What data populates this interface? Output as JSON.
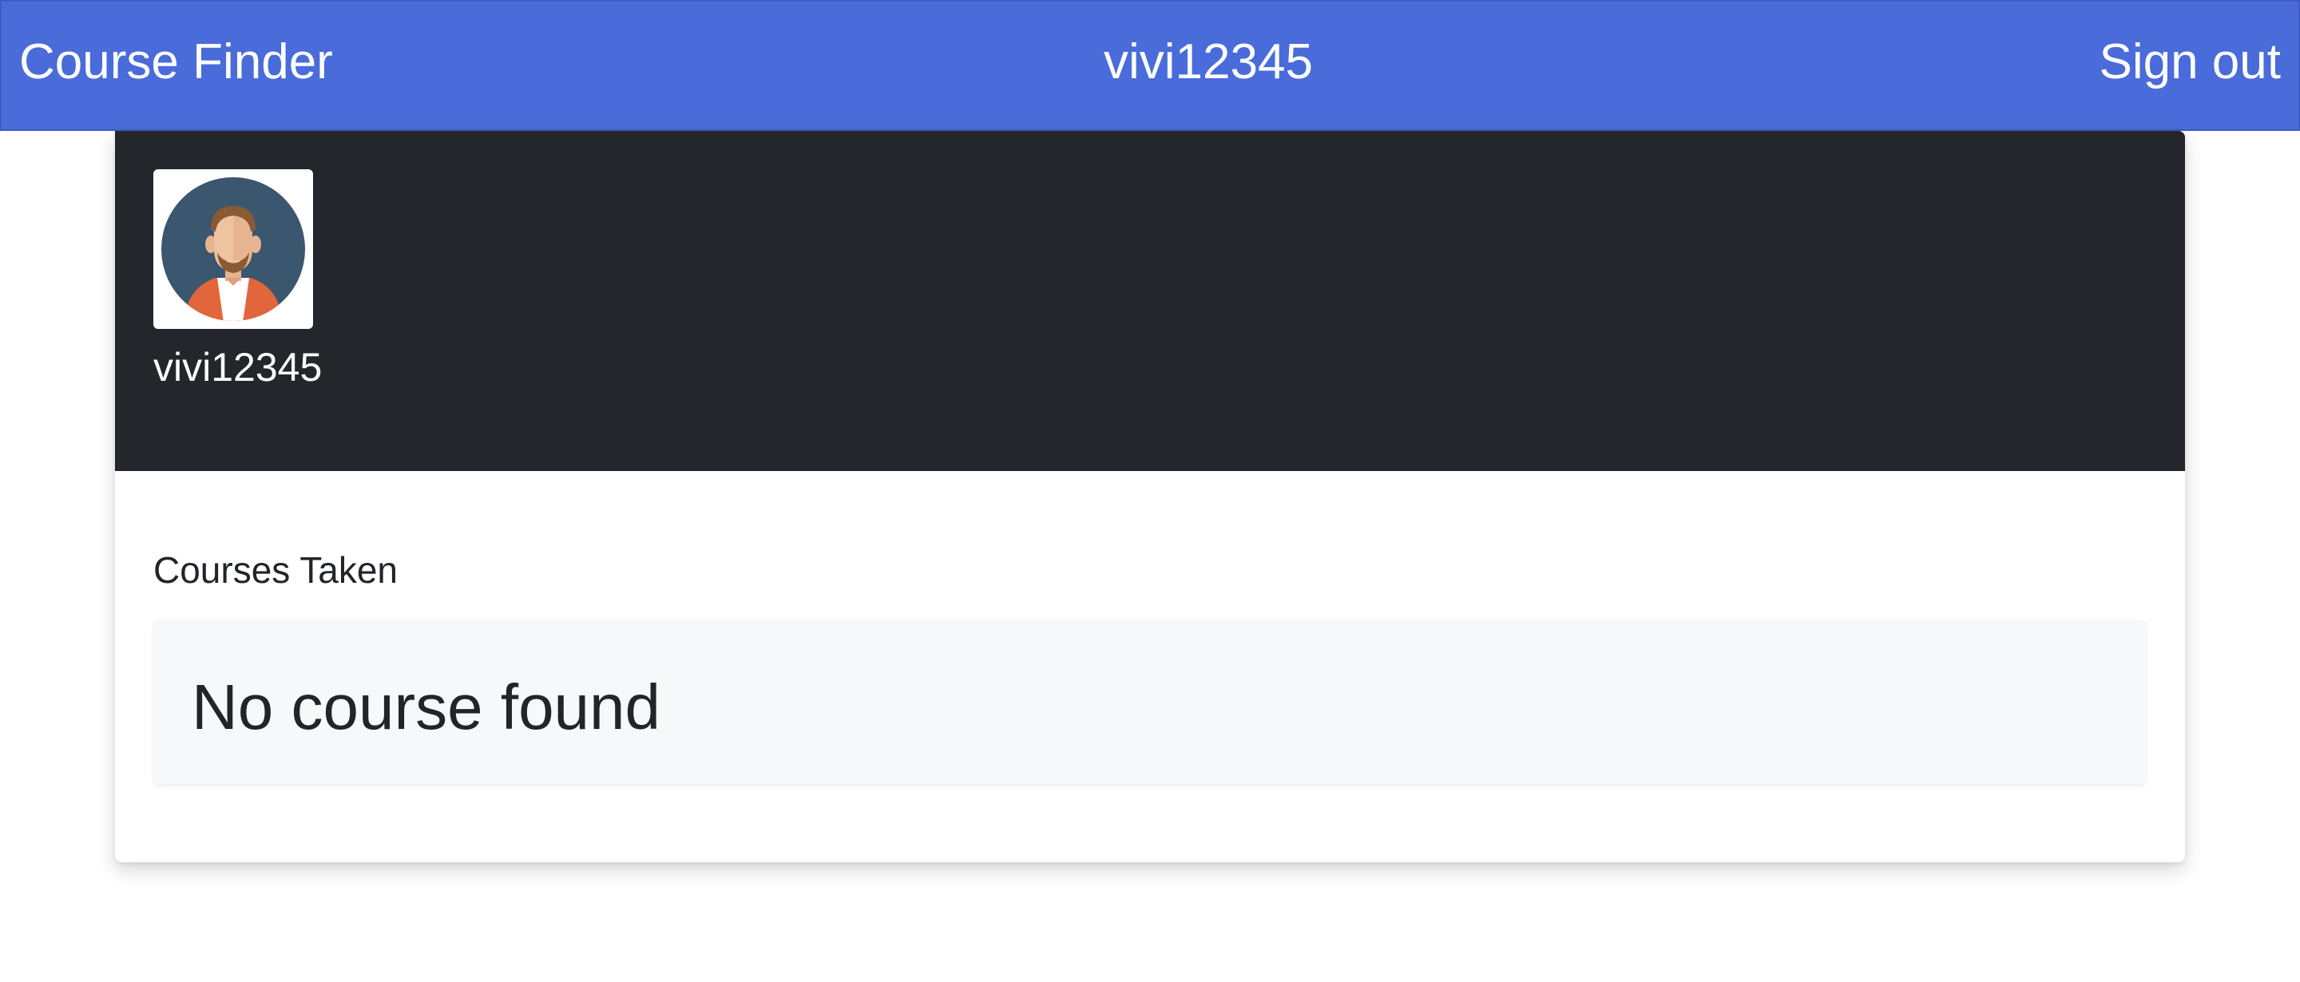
{
  "navbar": {
    "brand": "Course Finder",
    "username": "vivi12345",
    "signout_label": "Sign out",
    "color": "#4a6bda"
  },
  "profile": {
    "avatar_icon": "user-avatar-icon",
    "username": "vivi12345",
    "header_color": "#23262b"
  },
  "courses": {
    "section_title": "Courses Taken",
    "empty_message": "No course found"
  }
}
